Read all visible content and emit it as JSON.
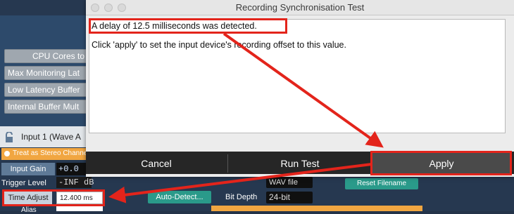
{
  "background": {
    "cpu_cores_label": "CPU Cores to",
    "settings": [
      "Max Monitoring Lat",
      "Low Latency Buffer",
      "Internal Buffer Mult"
    ],
    "input_title": "Input 1 (Wave A",
    "stereo_label": "Treat as Stereo Channel",
    "input_gain_label": "Input Gain",
    "input_gain_value": "+0.0",
    "trigger_level_label": "Trigger Level",
    "trigger_level_value": "-INF dB",
    "time_adjust_label": "Time Adjust",
    "time_adjust_value": "12.400 ms",
    "auto_detect_label": "Auto-Detect...",
    "alias_label": "Alias",
    "file_format": "WAV file",
    "reset_filename_label": "Reset Filename",
    "bit_depth_label": "Bit Depth",
    "bit_depth_value": "24-bit"
  },
  "dialog": {
    "title": "Recording Synchronisation Test",
    "message_line1": "A delay of 12.5 milliseconds was detected.",
    "message_line2": "Click 'apply' to set the input device's recording offset to this value.",
    "buttons": {
      "cancel": "Cancel",
      "run_test": "Run Test",
      "apply": "Apply"
    }
  },
  "colors": {
    "annotation_red": "#e3241b",
    "teal_button": "#2a9a8a",
    "orange_bar": "#f1a641"
  }
}
